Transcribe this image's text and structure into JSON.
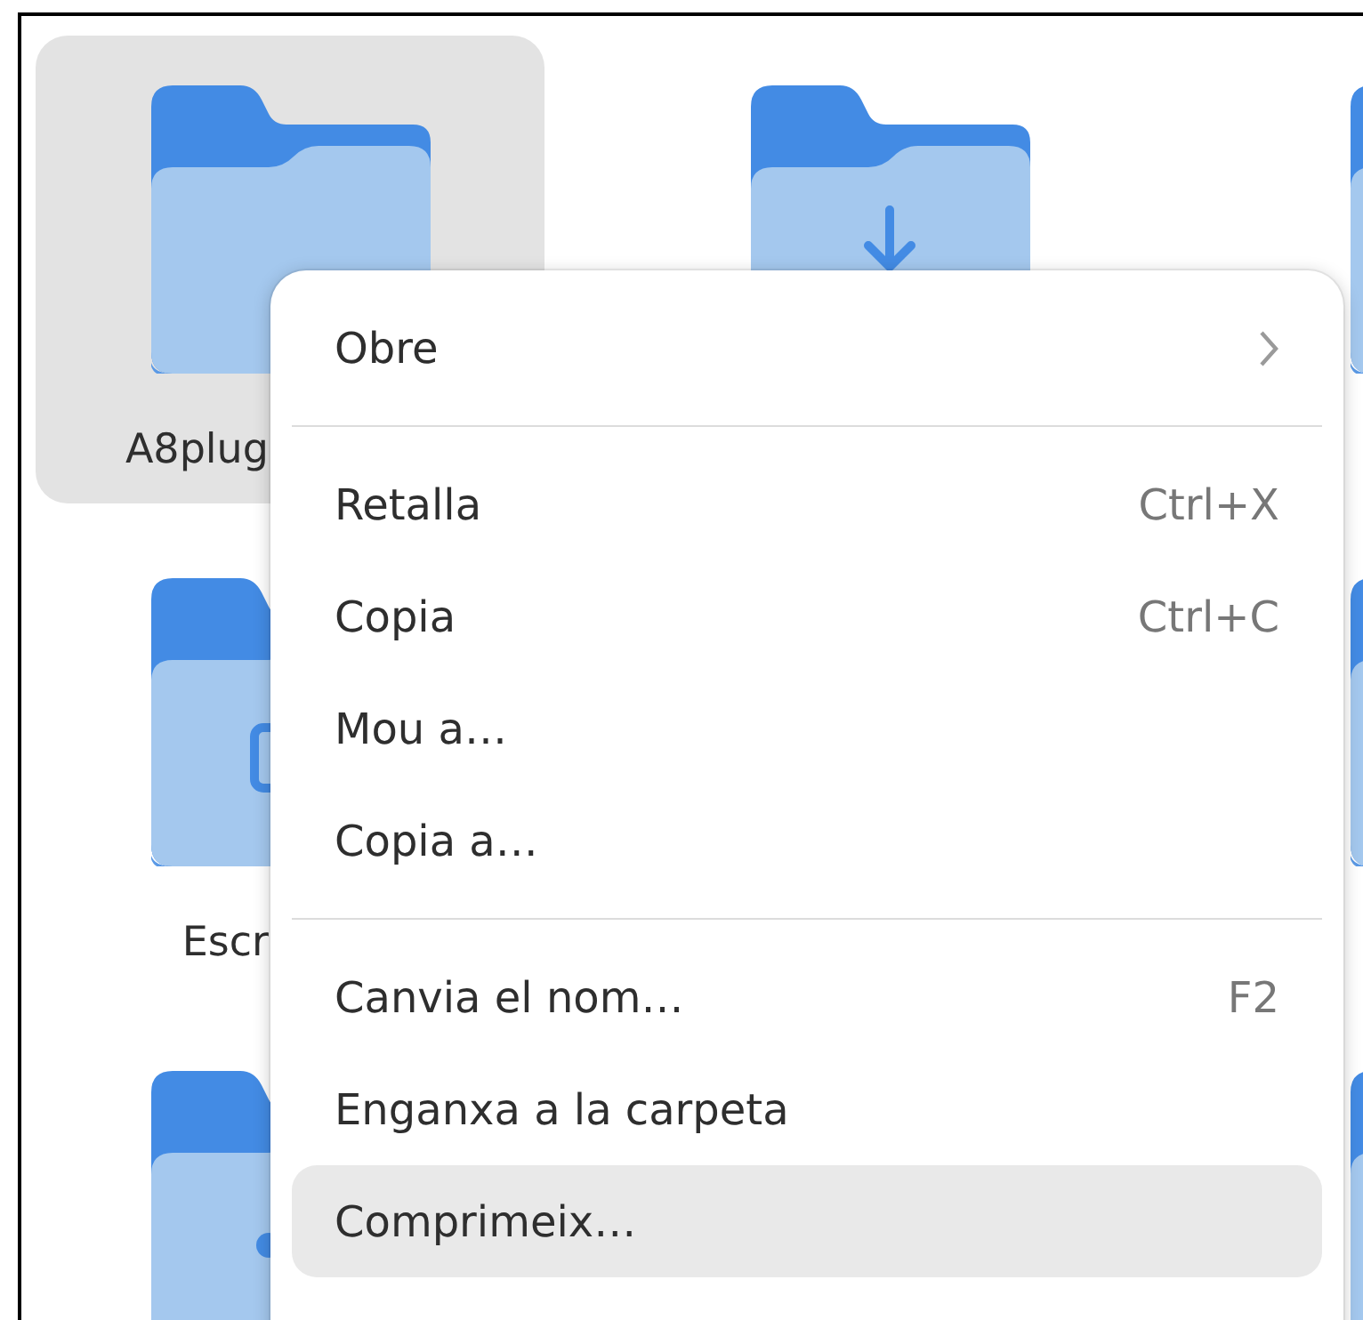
{
  "folder_grid": {
    "rows": [
      {
        "cells": [
          {
            "name": "A8plug",
            "selected": true,
            "kind": "plain"
          },
          {
            "selected": false,
            "kind": "download"
          },
          {
            "selected": false,
            "kind": "plain"
          }
        ]
      },
      {
        "cells": [
          {
            "name": "Escr",
            "selected": false,
            "kind": "document"
          },
          null,
          {
            "selected": false,
            "kind": "plain"
          }
        ]
      },
      {
        "cells": [
          {
            "selected": false,
            "kind": "share"
          },
          null,
          {
            "selected": false,
            "kind": "plain"
          }
        ]
      }
    ]
  },
  "context_menu": {
    "items": [
      {
        "kind": "item",
        "label": "Obre",
        "submenu": true,
        "selected": false
      },
      {
        "kind": "separator"
      },
      {
        "kind": "item",
        "label": "Retalla",
        "shortcut": "Ctrl+X",
        "submenu": false,
        "selected": false
      },
      {
        "kind": "item",
        "label": "Copia",
        "shortcut": "Ctrl+C",
        "submenu": false,
        "selected": false
      },
      {
        "kind": "item",
        "label": "Mou a…",
        "submenu": false,
        "selected": false
      },
      {
        "kind": "item",
        "label": "Copia a…",
        "submenu": false,
        "selected": false
      },
      {
        "kind": "separator"
      },
      {
        "kind": "item",
        "label": "Canvia el nom…",
        "shortcut": "F2",
        "submenu": false,
        "selected": false
      },
      {
        "kind": "item",
        "label": "Enganxa a la carpeta",
        "submenu": false,
        "selected": false
      },
      {
        "kind": "item",
        "label": "Comprimeix…",
        "submenu": false,
        "selected": true
      }
    ]
  }
}
